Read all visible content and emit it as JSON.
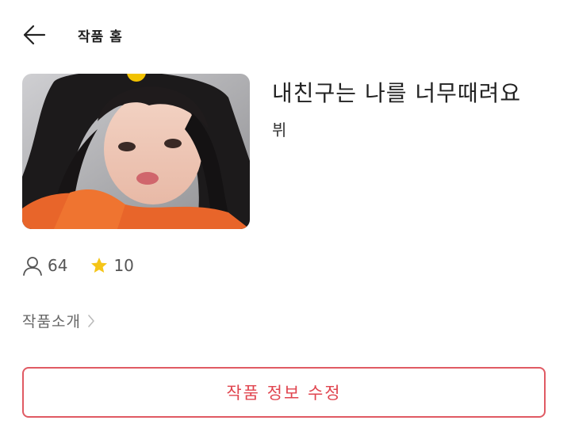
{
  "header": {
    "back_icon": "arrow-left-icon",
    "title": "작품 홈"
  },
  "work": {
    "title": "내친구는 나를 너무때려요",
    "author": "뷔",
    "cover_alt": "cover-image"
  },
  "stats": {
    "readers_icon": "person-icon",
    "readers": "64",
    "stars_icon": "star-icon",
    "stars": "10",
    "star_color": "#f5c518"
  },
  "intro": {
    "label": "작품소개",
    "chevron_icon": "chevron-right-icon"
  },
  "edit_button": {
    "label": "작품 정보 수정",
    "color": "#e0454f"
  }
}
